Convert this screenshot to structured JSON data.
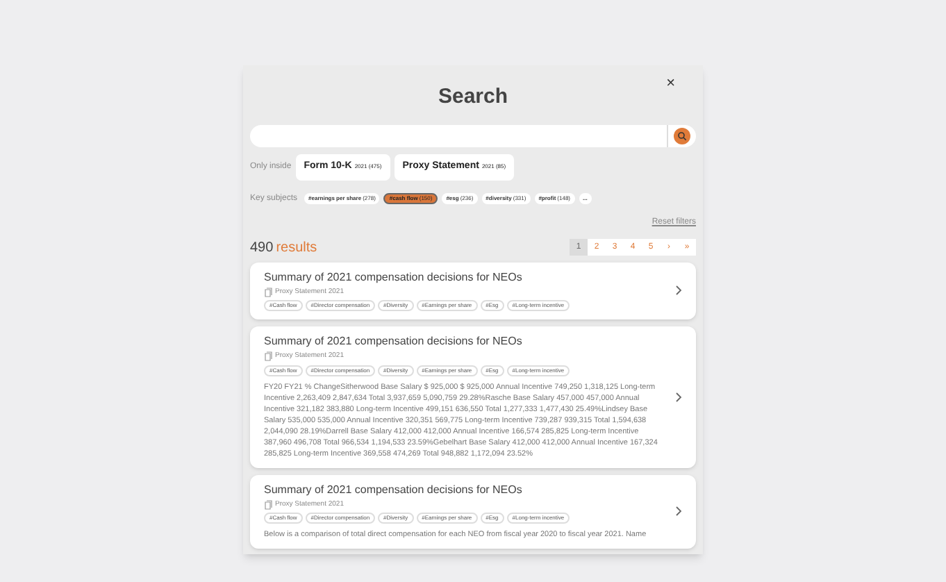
{
  "title": "Search",
  "close": "×",
  "only_inside": {
    "label": "Only inside",
    "options": [
      {
        "name": "Form 10-K",
        "year": "2021",
        "count": "(475)",
        "selected": false
      },
      {
        "name": "Proxy Statement",
        "year": "2021",
        "count": "(85)",
        "selected": false
      }
    ]
  },
  "key_subjects": {
    "label": "Key subjects",
    "tags": [
      {
        "name": "#earnings per share",
        "count": "(278)",
        "selected": false
      },
      {
        "name": "#cash flow",
        "count": "(150)",
        "selected": true
      },
      {
        "name": "#esg",
        "count": "(236)",
        "selected": false
      },
      {
        "name": "#diversity",
        "count": "(331)",
        "selected": false
      },
      {
        "name": "#profit",
        "count": "(148)",
        "selected": false
      },
      {
        "name": "...",
        "selected": false
      }
    ]
  },
  "reset_filters": "Reset filters",
  "results": {
    "count": "490",
    "label": "results"
  },
  "pagination": [
    {
      "label": "1",
      "selected": true
    },
    {
      "label": "2",
      "selected": false
    },
    {
      "label": "3",
      "selected": false
    },
    {
      "label": "4",
      "selected": false
    },
    {
      "label": "5",
      "selected": false
    },
    {
      "label": "›",
      "selected": false
    },
    {
      "label": "»",
      "selected": false
    }
  ],
  "cards": [
    {
      "title": "Summary of 2021 compensation decisions for NEOs",
      "source": "Proxy Statement 2021",
      "tags": [
        "#Cash flow",
        "#Director compensation",
        "#Diversity",
        "#Earnings per share",
        "#Esg",
        "#Long-term incentive"
      ]
    },
    {
      "title": "Summary of 2021 compensation decisions for NEOs",
      "source": "Proxy Statement 2021",
      "tags": [
        "#Cash flow",
        "#Director compensation",
        "#Diversity",
        "#Earnings per share",
        "#Esg",
        "#Long-term incentive"
      ],
      "text": "FY20 FY21 % ChangeSitherwood Base Salary $ 925,000 $ 925,000 Annual Incentive 749,250 1,318,125 Long-term Incentive 2,263,409 2,847,634 Total 3,937,659 5,090,759 29.28%Rasche Base Salary 457,000 457,000 Annual Incentive 321,182 383,880 Long-term Incentive 499,151 636,550 Total 1,277,333 1,477,430 25.49%Lindsey Base Salary 535,000 535,000 Annual Incentive 320,351 569,775 Long-term Incentive 739,287 939,315 Total 1,594,638 2,044,090 28.19%Darrell Base Salary 412,000 412,000 Annual Incentive 166,574 285,825 Long-term Incentive 387,960 496,708 Total 966,534 1,194,533 23.59%Gebelhart Base Salary 412,000 412,000 Annual Incentive 167,324 285,825 Long-term Incentive 369,558 474,269 Total 948,882 1,172,094 23.52%"
    },
    {
      "title": "Summary of 2021 compensation decisions for NEOs",
      "source": "Proxy Statement 2021",
      "tags": [
        "#Cash flow",
        "#Director compensation",
        "#Diversity",
        "#Earnings per share",
        "#Esg",
        "#Long-term incentive"
      ],
      "text": "Below is a comparison of total direct compensation for each NEO from fiscal year 2020 to fiscal year 2021. Name"
    }
  ]
}
